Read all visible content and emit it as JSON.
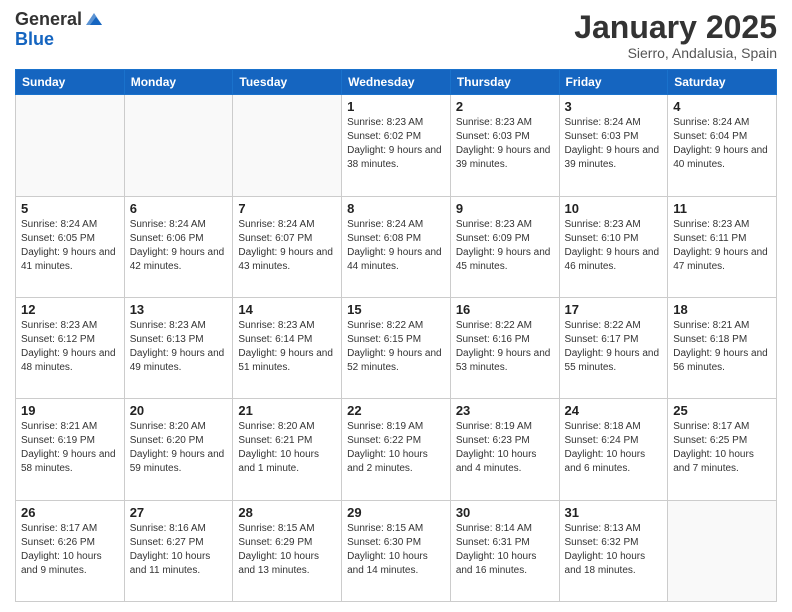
{
  "header": {
    "logo_general": "General",
    "logo_blue": "Blue",
    "month_title": "January 2025",
    "location": "Sierro, Andalusia, Spain"
  },
  "days_of_week": [
    "Sunday",
    "Monday",
    "Tuesday",
    "Wednesday",
    "Thursday",
    "Friday",
    "Saturday"
  ],
  "weeks": [
    [
      {
        "day": "",
        "info": ""
      },
      {
        "day": "",
        "info": ""
      },
      {
        "day": "",
        "info": ""
      },
      {
        "day": "1",
        "info": "Sunrise: 8:23 AM\nSunset: 6:02 PM\nDaylight: 9 hours and 38 minutes."
      },
      {
        "day": "2",
        "info": "Sunrise: 8:23 AM\nSunset: 6:03 PM\nDaylight: 9 hours and 39 minutes."
      },
      {
        "day": "3",
        "info": "Sunrise: 8:24 AM\nSunset: 6:03 PM\nDaylight: 9 hours and 39 minutes."
      },
      {
        "day": "4",
        "info": "Sunrise: 8:24 AM\nSunset: 6:04 PM\nDaylight: 9 hours and 40 minutes."
      }
    ],
    [
      {
        "day": "5",
        "info": "Sunrise: 8:24 AM\nSunset: 6:05 PM\nDaylight: 9 hours and 41 minutes."
      },
      {
        "day": "6",
        "info": "Sunrise: 8:24 AM\nSunset: 6:06 PM\nDaylight: 9 hours and 42 minutes."
      },
      {
        "day": "7",
        "info": "Sunrise: 8:24 AM\nSunset: 6:07 PM\nDaylight: 9 hours and 43 minutes."
      },
      {
        "day": "8",
        "info": "Sunrise: 8:24 AM\nSunset: 6:08 PM\nDaylight: 9 hours and 44 minutes."
      },
      {
        "day": "9",
        "info": "Sunrise: 8:23 AM\nSunset: 6:09 PM\nDaylight: 9 hours and 45 minutes."
      },
      {
        "day": "10",
        "info": "Sunrise: 8:23 AM\nSunset: 6:10 PM\nDaylight: 9 hours and 46 minutes."
      },
      {
        "day": "11",
        "info": "Sunrise: 8:23 AM\nSunset: 6:11 PM\nDaylight: 9 hours and 47 minutes."
      }
    ],
    [
      {
        "day": "12",
        "info": "Sunrise: 8:23 AM\nSunset: 6:12 PM\nDaylight: 9 hours and 48 minutes."
      },
      {
        "day": "13",
        "info": "Sunrise: 8:23 AM\nSunset: 6:13 PM\nDaylight: 9 hours and 49 minutes."
      },
      {
        "day": "14",
        "info": "Sunrise: 8:23 AM\nSunset: 6:14 PM\nDaylight: 9 hours and 51 minutes."
      },
      {
        "day": "15",
        "info": "Sunrise: 8:22 AM\nSunset: 6:15 PM\nDaylight: 9 hours and 52 minutes."
      },
      {
        "day": "16",
        "info": "Sunrise: 8:22 AM\nSunset: 6:16 PM\nDaylight: 9 hours and 53 minutes."
      },
      {
        "day": "17",
        "info": "Sunrise: 8:22 AM\nSunset: 6:17 PM\nDaylight: 9 hours and 55 minutes."
      },
      {
        "day": "18",
        "info": "Sunrise: 8:21 AM\nSunset: 6:18 PM\nDaylight: 9 hours and 56 minutes."
      }
    ],
    [
      {
        "day": "19",
        "info": "Sunrise: 8:21 AM\nSunset: 6:19 PM\nDaylight: 9 hours and 58 minutes."
      },
      {
        "day": "20",
        "info": "Sunrise: 8:20 AM\nSunset: 6:20 PM\nDaylight: 9 hours and 59 minutes."
      },
      {
        "day": "21",
        "info": "Sunrise: 8:20 AM\nSunset: 6:21 PM\nDaylight: 10 hours and 1 minute."
      },
      {
        "day": "22",
        "info": "Sunrise: 8:19 AM\nSunset: 6:22 PM\nDaylight: 10 hours and 2 minutes."
      },
      {
        "day": "23",
        "info": "Sunrise: 8:19 AM\nSunset: 6:23 PM\nDaylight: 10 hours and 4 minutes."
      },
      {
        "day": "24",
        "info": "Sunrise: 8:18 AM\nSunset: 6:24 PM\nDaylight: 10 hours and 6 minutes."
      },
      {
        "day": "25",
        "info": "Sunrise: 8:17 AM\nSunset: 6:25 PM\nDaylight: 10 hours and 7 minutes."
      }
    ],
    [
      {
        "day": "26",
        "info": "Sunrise: 8:17 AM\nSunset: 6:26 PM\nDaylight: 10 hours and 9 minutes."
      },
      {
        "day": "27",
        "info": "Sunrise: 8:16 AM\nSunset: 6:27 PM\nDaylight: 10 hours and 11 minutes."
      },
      {
        "day": "28",
        "info": "Sunrise: 8:15 AM\nSunset: 6:29 PM\nDaylight: 10 hours and 13 minutes."
      },
      {
        "day": "29",
        "info": "Sunrise: 8:15 AM\nSunset: 6:30 PM\nDaylight: 10 hours and 14 minutes."
      },
      {
        "day": "30",
        "info": "Sunrise: 8:14 AM\nSunset: 6:31 PM\nDaylight: 10 hours and 16 minutes."
      },
      {
        "day": "31",
        "info": "Sunrise: 8:13 AM\nSunset: 6:32 PM\nDaylight: 10 hours and 18 minutes."
      },
      {
        "day": "",
        "info": ""
      }
    ]
  ]
}
